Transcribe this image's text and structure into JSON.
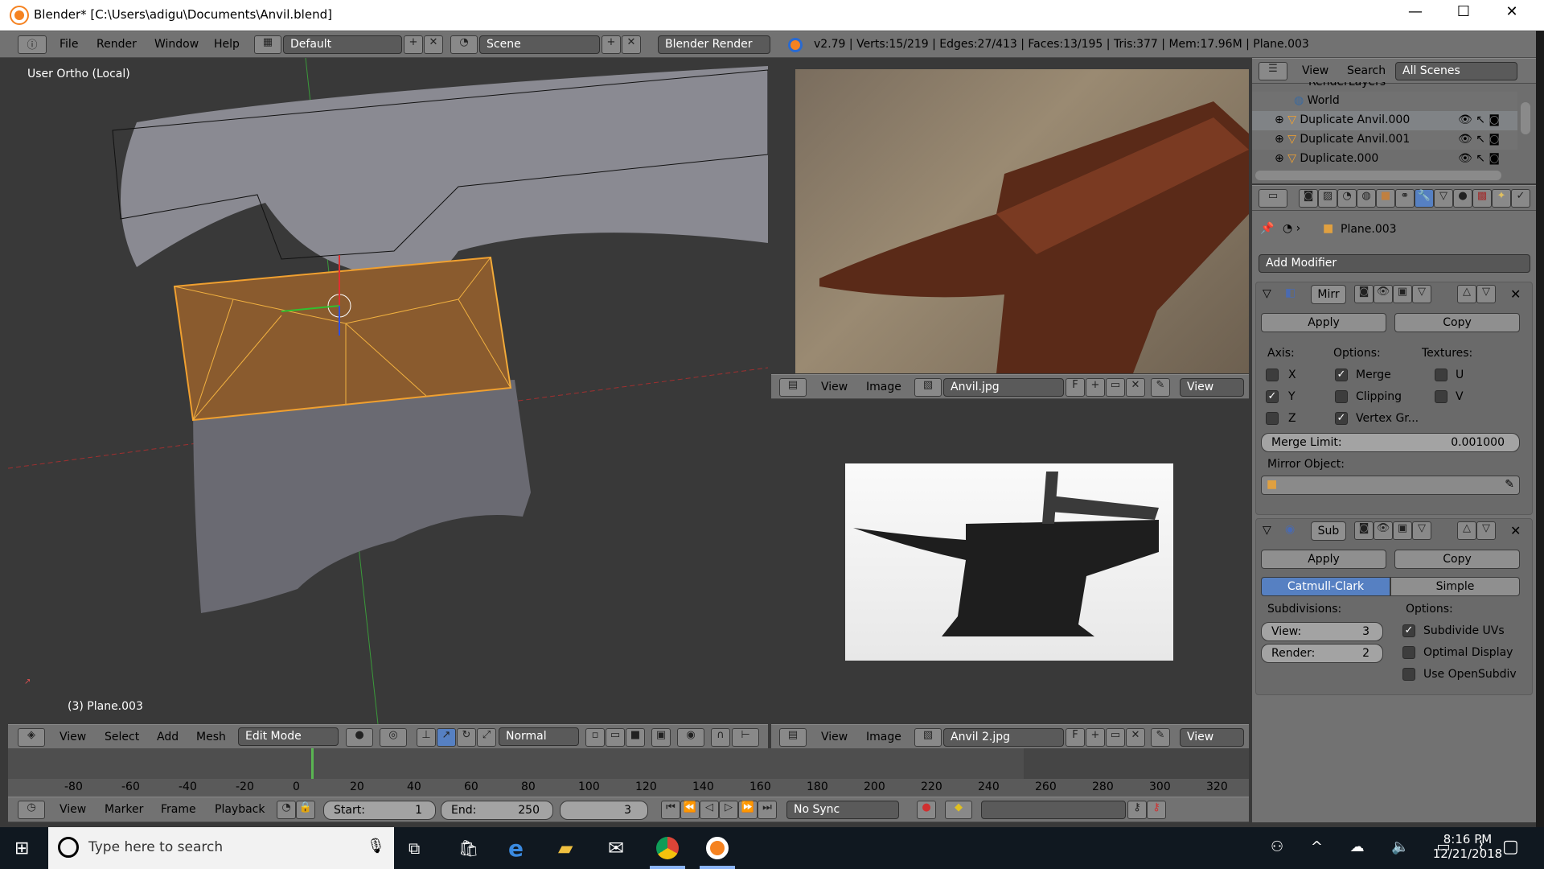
{
  "window": {
    "title": "Blender* [C:\\Users\\adigu\\Documents\\Anvil.blend]",
    "minimize": "—",
    "maximize": "☐",
    "close": "✕"
  },
  "topbar": {
    "menus": [
      "File",
      "Render",
      "Window",
      "Help"
    ],
    "layout": "Default",
    "scene": "Scene",
    "engine": "Blender Render",
    "stats": "v2.79 | Verts:15/219 | Edges:27/413 | Faces:13/195 | Tris:377 | Mem:17.96M | Plane.003"
  },
  "viewport": {
    "view_label": "User Ortho (Local)",
    "object_label": "(3) Plane.003",
    "header": {
      "menus": [
        "View",
        "Select",
        "Add",
        "Mesh"
      ],
      "mode": "Edit Mode",
      "orientation": "Normal"
    },
    "colors": {
      "selected_face": "#8c5a28",
      "edge": "#f0a030",
      "background": "#393939"
    }
  },
  "image_top": {
    "menus": [
      "View",
      "Image"
    ],
    "image_name": "Anvil.jpg",
    "fake_user": "F",
    "view": "View"
  },
  "image_bottom": {
    "menus": [
      "View",
      "Image"
    ],
    "image_name": "Anvil 2.jpg",
    "fake_user": "F",
    "view": "View"
  },
  "outliner": {
    "menus": [
      "View",
      "Search"
    ],
    "filter": "All Scenes",
    "items": [
      {
        "label": "RenderLayers",
        "icon": "renderlayers-icon"
      },
      {
        "label": "World",
        "icon": "world-icon"
      },
      {
        "label": "Duplicate Anvil.000",
        "icon": "mesh-icon"
      },
      {
        "label": "Duplicate Anvil.001",
        "icon": "mesh-icon"
      },
      {
        "label": "Duplicate.000",
        "icon": "mesh-icon"
      }
    ]
  },
  "properties": {
    "object": "Plane.003",
    "add_modifier": "Add Modifier",
    "mirror": {
      "name": "Mirr",
      "apply": "Apply",
      "copy": "Copy",
      "axis_label": "Axis:",
      "options_label": "Options:",
      "textures_label": "Textures:",
      "axes": [
        {
          "label": "X",
          "checked": false
        },
        {
          "label": "Y",
          "checked": true
        },
        {
          "label": "Z",
          "checked": false
        }
      ],
      "options": [
        {
          "label": "Merge",
          "checked": true
        },
        {
          "label": "Clipping",
          "checked": false
        },
        {
          "label": "Vertex Gr...",
          "checked": true
        }
      ],
      "textures": [
        {
          "label": "U",
          "checked": false
        },
        {
          "label": "V",
          "checked": false
        }
      ],
      "merge_limit_label": "Merge Limit:",
      "merge_limit": "0.001000",
      "mirror_object_label": "Mirror Object:"
    },
    "subsurf": {
      "name": "Sub",
      "apply": "Apply",
      "copy": "Copy",
      "catmull": "Catmull-Clark",
      "simple": "Simple",
      "subdivisions_label": "Subdivisions:",
      "options_label": "Options:",
      "view_label": "View:",
      "view": "3",
      "render_label": "Render:",
      "render": "2",
      "options": [
        {
          "label": "Subdivide UVs",
          "checked": true
        },
        {
          "label": "Optimal Display",
          "checked": false
        },
        {
          "label": "Use OpenSubdiv",
          "checked": false
        }
      ]
    }
  },
  "timeline": {
    "ticks": [
      "-80",
      "-60",
      "-40",
      "-20",
      "0",
      "20",
      "40",
      "60",
      "80",
      "100",
      "120",
      "140",
      "160",
      "180",
      "200",
      "220",
      "240",
      "260",
      "280",
      "300",
      "320"
    ],
    "current_frame": "3",
    "menus": [
      "View",
      "Marker",
      "Frame",
      "Playback"
    ],
    "start_label": "Start:",
    "start": "1",
    "end_label": "End:",
    "end": "250",
    "sync": "No Sync"
  },
  "taskbar": {
    "search_placeholder": "Type here to search",
    "time": "8:16 PM",
    "date": "12/21/2018"
  },
  "colors": {
    "accent": "#5680c2",
    "header": "#727272",
    "panel": "#727272"
  }
}
